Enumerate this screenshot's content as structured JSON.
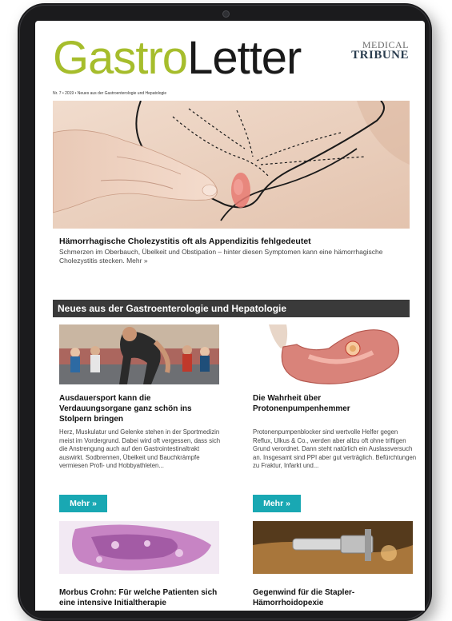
{
  "header": {
    "logo_part1": "Gastro",
    "logo_part2": "Letter",
    "brand_top": "MEDICAL",
    "brand_bottom": "TRIBUNE",
    "issue_line": "Nr. 7 • 2019 • Neues aus der Gastroenterologie und Hepatologie"
  },
  "lead": {
    "title": "Hämorrhagische Cholezystitis oft als Appendizitis fehlgedeutet",
    "text": "Schmerzen im Oberbauch, Übelkeit und Obstipation – hinter diesen Symptomen kann eine hämorrhagische Cholezystitis stecken. Mehr »"
  },
  "section": {
    "title": "Neues aus der Gastroenterologie und Hepatologie"
  },
  "articles": [
    {
      "title": "Ausdauersport kann die Verdauungsorgane ganz schön ins Stolpern bringen",
      "text": "Herz, Muskulatur und Gelenke stehen in der Sportmedizin meist im Vordergrund. Dabei wird oft vergessen, dass sich die Anstrengung auch auf den Gastrointestinaltrakt auswirkt. Sodbrennen, Übelkeit und Bauchkrämpfe vermiesen Profi- und Hobbyathleten...",
      "button": "Mehr »"
    },
    {
      "title": "Die Wahrheit über Protonenpumpenhemmer",
      "text": "Protonenpumpenblocker sind wertvolle Helfer gegen Reflux, Ulkus & Co., werden aber allzu oft ohne triftigen Grund verordnet. Dann steht natürlich ein Auslassversuch an. Insgesamt sind PPI aber gut verträglich. Befürchtungen zu Fraktur, Infarkt und...",
      "button": "Mehr »"
    },
    {
      "title": "Morbus Crohn: Für welche Patienten sich eine intensive Initialtherapie"
    },
    {
      "title": "Gegenwind für die Stapler-Hämorrhoidopexie"
    }
  ],
  "colors": {
    "logo_green": "#a6bd2c",
    "section_bar": "#3a3a3a",
    "button": "#19a8b3"
  }
}
